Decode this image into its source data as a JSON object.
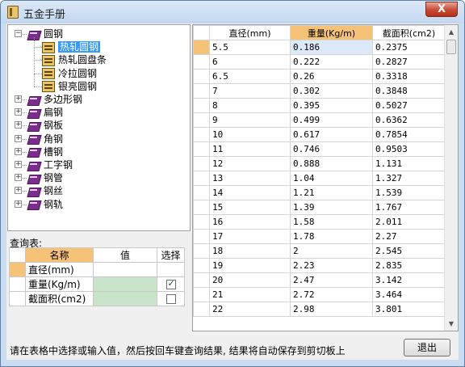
{
  "window": {
    "title": "五金手册",
    "close_glyph": "X"
  },
  "tree": {
    "nodes": [
      {
        "label": "圆钢",
        "icon": "book-icon",
        "expander": "−",
        "expanded": true,
        "children": [
          {
            "label": "热轧圆钢",
            "icon": "rack-icon",
            "selected": true
          },
          {
            "label": "热轧圆盘条",
            "icon": "rack-icon"
          },
          {
            "label": "冷拉圆钢",
            "icon": "rack-icon"
          },
          {
            "label": "银亮圆钢",
            "icon": "rack-icon"
          }
        ]
      },
      {
        "label": "多边形钢",
        "icon": "book-icon",
        "expander": "+"
      },
      {
        "label": "扁钢",
        "icon": "book-icon",
        "expander": "+"
      },
      {
        "label": "钢板",
        "icon": "book-icon",
        "expander": "+"
      },
      {
        "label": "角钢",
        "icon": "book-icon",
        "expander": "+"
      },
      {
        "label": "槽钢",
        "icon": "book-icon",
        "expander": "+"
      },
      {
        "label": "工字钢",
        "icon": "book-icon",
        "expander": "+"
      },
      {
        "label": "钢管",
        "icon": "book-icon",
        "expander": "+"
      },
      {
        "label": "钢丝",
        "icon": "book-icon",
        "expander": "+"
      },
      {
        "label": "钢轨",
        "icon": "book-icon",
        "expander": "+"
      }
    ]
  },
  "query": {
    "label": "查询表:",
    "headers": {
      "name": "名称",
      "value": "值",
      "select": "选择"
    },
    "rows": [
      {
        "name": "直径(mm)",
        "value": "",
        "checked": null
      },
      {
        "name": "重量(Kg/m)",
        "value": "",
        "checked": true
      },
      {
        "name": "截面积(cm2)",
        "value": "",
        "checked": false
      }
    ]
  },
  "grid": {
    "headers": [
      "直径(mm)",
      "重量(Kg/m)",
      "截面积(cm2)"
    ],
    "rows": [
      [
        "5.5",
        "0.186",
        "0.2375"
      ],
      [
        "6",
        "0.222",
        "0.2827"
      ],
      [
        "6.5",
        "0.26",
        "0.3318"
      ],
      [
        "7",
        "0.302",
        "0.3848"
      ],
      [
        "8",
        "0.395",
        "0.5027"
      ],
      [
        "9",
        "0.499",
        "0.6362"
      ],
      [
        "10",
        "0.617",
        "0.7854"
      ],
      [
        "11",
        "0.746",
        "0.9503"
      ],
      [
        "12",
        "0.888",
        "1.131"
      ],
      [
        "13",
        "1.04",
        "1.327"
      ],
      [
        "14",
        "1.21",
        "1.539"
      ],
      [
        "15",
        "1.39",
        "1.767"
      ],
      [
        "16",
        "1.58",
        "2.011"
      ],
      [
        "17",
        "1.78",
        "2.27"
      ],
      [
        "18",
        "2",
        "2.545"
      ],
      [
        "19",
        "2.23",
        "2.835"
      ],
      [
        "20",
        "2.47",
        "3.142"
      ],
      [
        "21",
        "2.72",
        "3.464"
      ],
      [
        "22",
        "2.98",
        "3.801"
      ]
    ]
  },
  "status": {
    "text": "请在表格中选择或输入值，然后按回车键查询结果, 结果将自动保存到剪切板上"
  },
  "buttons": {
    "exit": "退出"
  },
  "colors": {
    "header_highlight": "#f6c278",
    "selection": "#3399ff",
    "value_green": "#c9e4c9"
  }
}
